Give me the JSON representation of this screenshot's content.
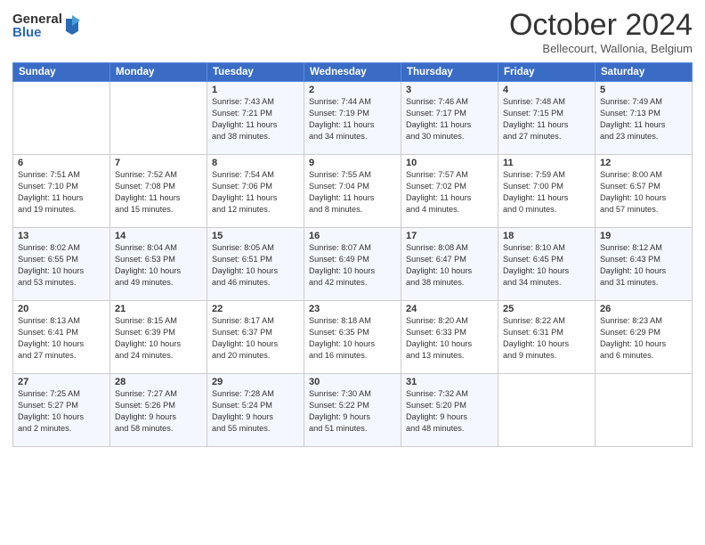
{
  "logo": {
    "general": "General",
    "blue": "Blue"
  },
  "header": {
    "month": "October 2024",
    "location": "Bellecourt, Wallonia, Belgium"
  },
  "days_of_week": [
    "Sunday",
    "Monday",
    "Tuesday",
    "Wednesday",
    "Thursday",
    "Friday",
    "Saturday"
  ],
  "weeks": [
    [
      {
        "day": "",
        "info": ""
      },
      {
        "day": "",
        "info": ""
      },
      {
        "day": "1",
        "info": "Sunrise: 7:43 AM\nSunset: 7:21 PM\nDaylight: 11 hours\nand 38 minutes."
      },
      {
        "day": "2",
        "info": "Sunrise: 7:44 AM\nSunset: 7:19 PM\nDaylight: 11 hours\nand 34 minutes."
      },
      {
        "day": "3",
        "info": "Sunrise: 7:46 AM\nSunset: 7:17 PM\nDaylight: 11 hours\nand 30 minutes."
      },
      {
        "day": "4",
        "info": "Sunrise: 7:48 AM\nSunset: 7:15 PM\nDaylight: 11 hours\nand 27 minutes."
      },
      {
        "day": "5",
        "info": "Sunrise: 7:49 AM\nSunset: 7:13 PM\nDaylight: 11 hours\nand 23 minutes."
      }
    ],
    [
      {
        "day": "6",
        "info": "Sunrise: 7:51 AM\nSunset: 7:10 PM\nDaylight: 11 hours\nand 19 minutes."
      },
      {
        "day": "7",
        "info": "Sunrise: 7:52 AM\nSunset: 7:08 PM\nDaylight: 11 hours\nand 15 minutes."
      },
      {
        "day": "8",
        "info": "Sunrise: 7:54 AM\nSunset: 7:06 PM\nDaylight: 11 hours\nand 12 minutes."
      },
      {
        "day": "9",
        "info": "Sunrise: 7:55 AM\nSunset: 7:04 PM\nDaylight: 11 hours\nand 8 minutes."
      },
      {
        "day": "10",
        "info": "Sunrise: 7:57 AM\nSunset: 7:02 PM\nDaylight: 11 hours\nand 4 minutes."
      },
      {
        "day": "11",
        "info": "Sunrise: 7:59 AM\nSunset: 7:00 PM\nDaylight: 11 hours\nand 0 minutes."
      },
      {
        "day": "12",
        "info": "Sunrise: 8:00 AM\nSunset: 6:57 PM\nDaylight: 10 hours\nand 57 minutes."
      }
    ],
    [
      {
        "day": "13",
        "info": "Sunrise: 8:02 AM\nSunset: 6:55 PM\nDaylight: 10 hours\nand 53 minutes."
      },
      {
        "day": "14",
        "info": "Sunrise: 8:04 AM\nSunset: 6:53 PM\nDaylight: 10 hours\nand 49 minutes."
      },
      {
        "day": "15",
        "info": "Sunrise: 8:05 AM\nSunset: 6:51 PM\nDaylight: 10 hours\nand 46 minutes."
      },
      {
        "day": "16",
        "info": "Sunrise: 8:07 AM\nSunset: 6:49 PM\nDaylight: 10 hours\nand 42 minutes."
      },
      {
        "day": "17",
        "info": "Sunrise: 8:08 AM\nSunset: 6:47 PM\nDaylight: 10 hours\nand 38 minutes."
      },
      {
        "day": "18",
        "info": "Sunrise: 8:10 AM\nSunset: 6:45 PM\nDaylight: 10 hours\nand 34 minutes."
      },
      {
        "day": "19",
        "info": "Sunrise: 8:12 AM\nSunset: 6:43 PM\nDaylight: 10 hours\nand 31 minutes."
      }
    ],
    [
      {
        "day": "20",
        "info": "Sunrise: 8:13 AM\nSunset: 6:41 PM\nDaylight: 10 hours\nand 27 minutes."
      },
      {
        "day": "21",
        "info": "Sunrise: 8:15 AM\nSunset: 6:39 PM\nDaylight: 10 hours\nand 24 minutes."
      },
      {
        "day": "22",
        "info": "Sunrise: 8:17 AM\nSunset: 6:37 PM\nDaylight: 10 hours\nand 20 minutes."
      },
      {
        "day": "23",
        "info": "Sunrise: 8:18 AM\nSunset: 6:35 PM\nDaylight: 10 hours\nand 16 minutes."
      },
      {
        "day": "24",
        "info": "Sunrise: 8:20 AM\nSunset: 6:33 PM\nDaylight: 10 hours\nand 13 minutes."
      },
      {
        "day": "25",
        "info": "Sunrise: 8:22 AM\nSunset: 6:31 PM\nDaylight: 10 hours\nand 9 minutes."
      },
      {
        "day": "26",
        "info": "Sunrise: 8:23 AM\nSunset: 6:29 PM\nDaylight: 10 hours\nand 6 minutes."
      }
    ],
    [
      {
        "day": "27",
        "info": "Sunrise: 7:25 AM\nSunset: 5:27 PM\nDaylight: 10 hours\nand 2 minutes."
      },
      {
        "day": "28",
        "info": "Sunrise: 7:27 AM\nSunset: 5:26 PM\nDaylight: 9 hours\nand 58 minutes."
      },
      {
        "day": "29",
        "info": "Sunrise: 7:28 AM\nSunset: 5:24 PM\nDaylight: 9 hours\nand 55 minutes."
      },
      {
        "day": "30",
        "info": "Sunrise: 7:30 AM\nSunset: 5:22 PM\nDaylight: 9 hours\nand 51 minutes."
      },
      {
        "day": "31",
        "info": "Sunrise: 7:32 AM\nSunset: 5:20 PM\nDaylight: 9 hours\nand 48 minutes."
      },
      {
        "day": "",
        "info": ""
      },
      {
        "day": "",
        "info": ""
      }
    ]
  ]
}
